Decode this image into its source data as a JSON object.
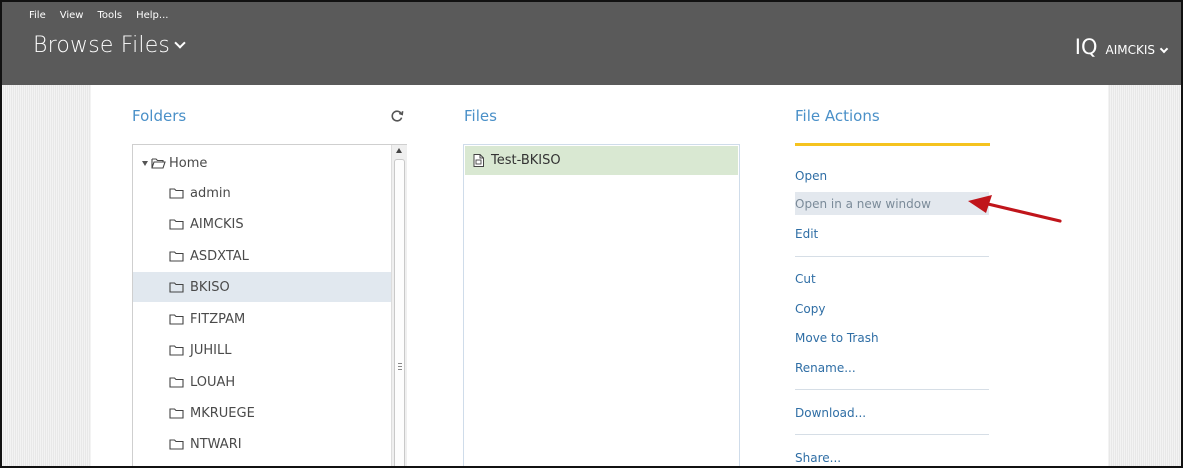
{
  "menu": [
    "File",
    "View",
    "Tools",
    "Help..."
  ],
  "app": {
    "title": "Browse Files"
  },
  "user": {
    "logo": "IQ",
    "name": "AIMCKIS"
  },
  "columns": {
    "folders": "Folders",
    "files": "Files",
    "actions": "File Actions"
  },
  "folders": {
    "root": "Home",
    "items": [
      "admin",
      "AIMCKIS",
      "ASDXTAL",
      "BKISO",
      "FITZPAM",
      "JUHILL",
      "LOUAH",
      "MKRUEGE",
      "NTWARI"
    ],
    "selected": "BKISO"
  },
  "files": [
    {
      "name": "Test-BKISO"
    }
  ],
  "actions": {
    "open": "Open",
    "open_new_window": "Open in a new window",
    "edit": "Edit",
    "cut": "Cut",
    "copy": "Copy",
    "move_to_trash": "Move to Trash",
    "rename": "Rename...",
    "download": "Download...",
    "share": "Share..."
  },
  "colors": {
    "accent": "#4a90c8",
    "topbar": "#5a5a5a",
    "actions_bar": "#f5c31f",
    "arrow": "#c0151b"
  },
  "icons": {
    "refresh": "refresh-icon",
    "folder": "folder-icon",
    "file": "file-icon"
  }
}
